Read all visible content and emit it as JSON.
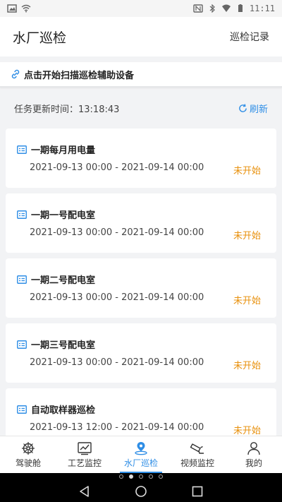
{
  "status_bar": {
    "time": "11:11"
  },
  "header": {
    "title": "水厂巡检",
    "link": "巡检记录"
  },
  "scan_banner": {
    "text": "点击开始扫描巡检辅助设备"
  },
  "update": {
    "label": "任务更新时间：13:18:43",
    "refresh": "刷新"
  },
  "tasks": [
    {
      "title": "一期每月用电量",
      "time": "2021-09-13 00:00 - 2021-09-14 00:00",
      "status": "未开始"
    },
    {
      "title": "一期一号配电室",
      "time": "2021-09-13 00:00 - 2021-09-14 00:00",
      "status": "未开始"
    },
    {
      "title": "一期二号配电室",
      "time": "2021-09-13 00:00 - 2021-09-14 00:00",
      "status": "未开始"
    },
    {
      "title": "一期三号配电室",
      "time": "2021-09-13 00:00 - 2021-09-14 00:00",
      "status": "未开始"
    },
    {
      "title": "自动取样器巡检",
      "time": "2021-09-13 12:00 - 2021-09-14 00:00",
      "status": "未开始"
    }
  ],
  "tabs": [
    {
      "label": "驾驶舱",
      "icon": "helm-icon"
    },
    {
      "label": "工艺监控",
      "icon": "chart-icon"
    },
    {
      "label": "水厂巡检",
      "icon": "location-icon",
      "active": true
    },
    {
      "label": "视频监控",
      "icon": "camera-icon"
    },
    {
      "label": "我的",
      "icon": "user-icon"
    }
  ],
  "colors": {
    "accent": "#2f8ee6",
    "status_pending": "#e8900c"
  }
}
